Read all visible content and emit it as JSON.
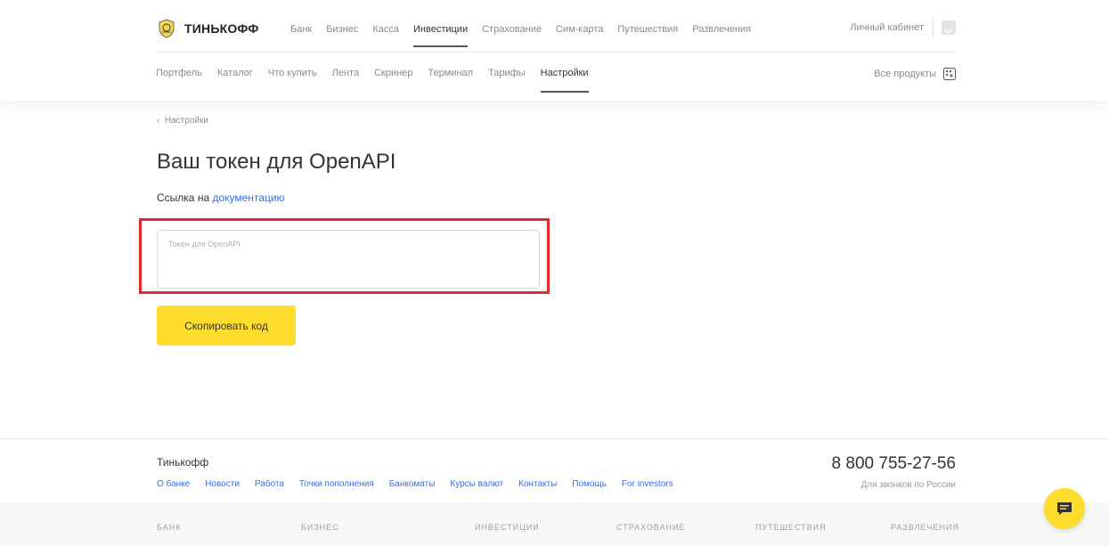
{
  "brand": {
    "name": "ТИНЬКОФФ"
  },
  "topnav": {
    "items": [
      {
        "label": "Банк"
      },
      {
        "label": "Бизнес"
      },
      {
        "label": "Касса"
      },
      {
        "label": "Инвестиции",
        "active": true
      },
      {
        "label": "Страхование"
      },
      {
        "label": "Сим-карта"
      },
      {
        "label": "Путешествия"
      },
      {
        "label": "Развлечения"
      }
    ],
    "cabinet_label": "Личный кабинет"
  },
  "subnav": {
    "items": [
      {
        "label": "Портфель"
      },
      {
        "label": "Каталог"
      },
      {
        "label": "Что купить"
      },
      {
        "label": "Лента"
      },
      {
        "label": "Скринер"
      },
      {
        "label": "Терминал"
      },
      {
        "label": "Тарифы"
      },
      {
        "label": "Настройки",
        "active": true
      }
    ],
    "all_products_label": "Все продукты"
  },
  "main": {
    "breadcrumb": "Настройки",
    "title": "Ваш токен для OpenAPI",
    "doc_prefix": "Ссылка на ",
    "doc_link": "документацию",
    "token_placeholder": "Токен для OpenAPI",
    "token_value": "",
    "copy_button": "Скопировать код"
  },
  "footer": {
    "brand": "Тинькофф",
    "links": [
      "О банке",
      "Новости",
      "Работа",
      "Точки пополнения",
      "Банкоматы",
      "Курсы валют",
      "Контакты",
      "Помощь",
      "For investors"
    ],
    "phone": "8 800 755-27-56",
    "phone_note": "Для звонков по России",
    "categories": [
      "БАНК",
      "БИЗНЕС",
      "ИНВЕСТИЦИИ",
      "СТРАХОВАНИЕ",
      "ПУТЕШЕСТВИЯ",
      "РАЗВЛЕЧЕНИЯ"
    ]
  },
  "colors": {
    "accent_yellow": "#ffdd2d",
    "link_blue": "#336fee",
    "highlight_red": "#e5262b"
  }
}
